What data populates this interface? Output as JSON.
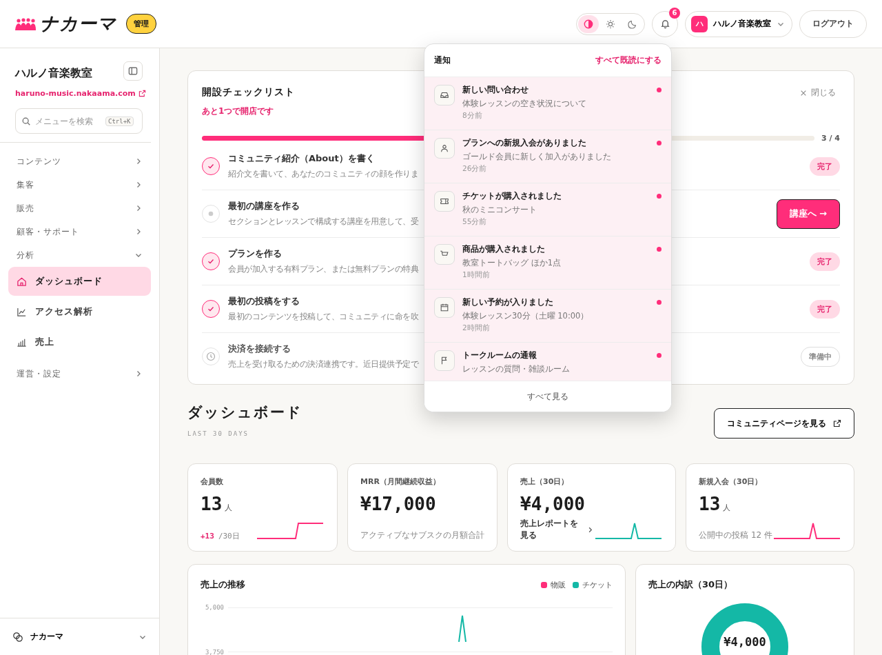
{
  "header": {
    "logo": "ナカーマ",
    "badge": "管理",
    "theme_modes": [
      {
        "selected": true
      },
      {
        "selected": false
      },
      {
        "selected": false
      }
    ],
    "notification_count": "6",
    "account": {
      "initial": "ハ",
      "name": "ハルノ音楽教室"
    },
    "logout": "ログアウト"
  },
  "sidebar": {
    "title": "ハルノ音楽教室",
    "link": "haruno-music.nakaama.com",
    "search": {
      "placeholder": "メニューを検索",
      "shortcut": "Ctrl+K"
    },
    "nav": [
      {
        "label": "コンテンツ",
        "expanded": false
      },
      {
        "label": "集客",
        "expanded": false
      },
      {
        "label": "販売",
        "expanded": false
      },
      {
        "label": "顧客・サポート",
        "expanded": false
      },
      {
        "label": "分析",
        "expanded": true,
        "children": [
          {
            "label": "ダッシュボード",
            "selected": true
          },
          {
            "label": "アクセス解析",
            "selected": false
          },
          {
            "label": "売上",
            "selected": false
          }
        ]
      },
      {
        "label": "運営・設定",
        "expanded": false
      }
    ],
    "footer": "ナカーマ"
  },
  "checklist": {
    "title": "開設チェックリスト",
    "subtitle": "あと1つで開店です",
    "close": "閉じる",
    "level": 0.75,
    "progress": "3 / 4",
    "items": [
      {
        "kind": "done",
        "title": "コミュニティ紹介（About）を書く",
        "description": "紹介文を書いて、あなたのコミュニティの顔を作りま",
        "action": "完了"
      },
      {
        "kind": "current",
        "title": "最初の講座を作る",
        "description": "セクションとレッスンで構成する講座を用意して、受",
        "action": "講座へ →"
      },
      {
        "kind": "done",
        "title": "プランを作る",
        "description": "会員が加入する有料プラン、または無料プランの特典",
        "action": "完了"
      },
      {
        "kind": "done",
        "title": "最初の投稿をする",
        "description": "最初のコンテンツを投稿して、コミュニティに命を吹",
        "action": "完了"
      },
      {
        "kind": "upcoming",
        "title": "決済を接続する",
        "description": "売上を受け取るための決済連携です。近日提供予定で",
        "action": "準備中"
      }
    ]
  },
  "dashboard": {
    "title": "ダッシュボード",
    "subtitle": "LAST 30 DAYS",
    "community_button": "コミュニティページを見る",
    "stats": [
      {
        "label": "会員数",
        "value": "13",
        "unit": "人",
        "delta": "+13",
        "period": "/30日",
        "color": "#ff2d7a"
      },
      {
        "label": "MRR（月間継続収益）",
        "value": "¥17,000",
        "note": "アクティブなサブスクの月額合計"
      },
      {
        "label": "売上（30日）",
        "value": "¥4,000",
        "link": "売上レポートを見る",
        "color": "#14b8a6"
      },
      {
        "label": "新規入会（30日）",
        "value": "13",
        "unit": "人",
        "note": "公開中の投稿 12 件",
        "color": "#ff2d7a"
      }
    ],
    "sales_trend": {
      "title": "売上の推移",
      "legend": [
        {
          "name": "物販",
          "color": "#ff2d7a"
        },
        {
          "name": "チケット",
          "color": "#14b8a6"
        }
      ],
      "y_labels": [
        "5,000",
        "3,750"
      ]
    },
    "breakdown": {
      "title": "売上の内訳（30日）",
      "center": "¥4,000"
    }
  },
  "notifications": {
    "title": "通知",
    "mark_all": "すべて既読にする",
    "view_all": "すべて見る",
    "items": [
      {
        "title": "新しい問い合わせ",
        "detail": "体験レッスンの空き状況について",
        "time": "8分前",
        "unread": true
      },
      {
        "title": "プランへの新規入会がありました",
        "detail": "ゴールド会員に新しく加入がありました",
        "time": "26分前",
        "unread": true
      },
      {
        "title": "チケットが購入されました",
        "detail": "秋のミニコンサート",
        "time": "55分前",
        "unread": true
      },
      {
        "title": "商品が購入されました",
        "detail": "教室トートバッグ ほか1点",
        "time": "1時間前",
        "unread": true
      },
      {
        "title": "新しい予約が入りました",
        "detail": "体験レッスン30分（土曜 10:00）",
        "time": "2時間前",
        "unread": true
      },
      {
        "title": "トークルームの通報",
        "detail": "レッスンの質問・雑談ルーム",
        "unread": true
      }
    ]
  }
}
